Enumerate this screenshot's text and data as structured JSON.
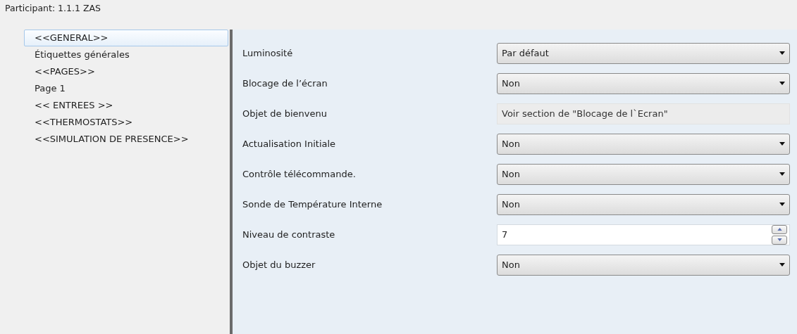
{
  "window": {
    "title": "Participant: 1.1.1  ZAS"
  },
  "sidebar": {
    "items": [
      {
        "label": "<<GENERAL>>",
        "selected": true
      },
      {
        "label": "Étiquettes générales",
        "selected": false
      },
      {
        "label": "<<PAGES>>",
        "selected": false
      },
      {
        "label": "Page 1",
        "selected": false
      },
      {
        "label": "<< ENTREES >>",
        "selected": false
      },
      {
        "label": "<<THERMOSTATS>>",
        "selected": false
      },
      {
        "label": "<<SIMULATION DE PRESENCE>>",
        "selected": false
      }
    ]
  },
  "parameters": [
    {
      "label": "Luminosité",
      "kind": "dropdown",
      "value": "Par défaut"
    },
    {
      "label": "Blocage de l’écran",
      "kind": "dropdown",
      "value": "Non"
    },
    {
      "label": "Objet de bienvenu",
      "kind": "readonly",
      "value": "Voir section de \"Blocage de l`Ecran\""
    },
    {
      "label": "Actualisation Initiale",
      "kind": "dropdown",
      "value": "Non"
    },
    {
      "label": "Contrôle télécommande.",
      "kind": "dropdown",
      "value": "Non"
    },
    {
      "label": "Sonde de Température Interne",
      "kind": "dropdown",
      "value": "Non"
    },
    {
      "label": "Niveau de contraste",
      "kind": "spinner",
      "value": "7"
    },
    {
      "label": "Objet du buzzer",
      "kind": "dropdown",
      "value": "Non"
    }
  ]
}
